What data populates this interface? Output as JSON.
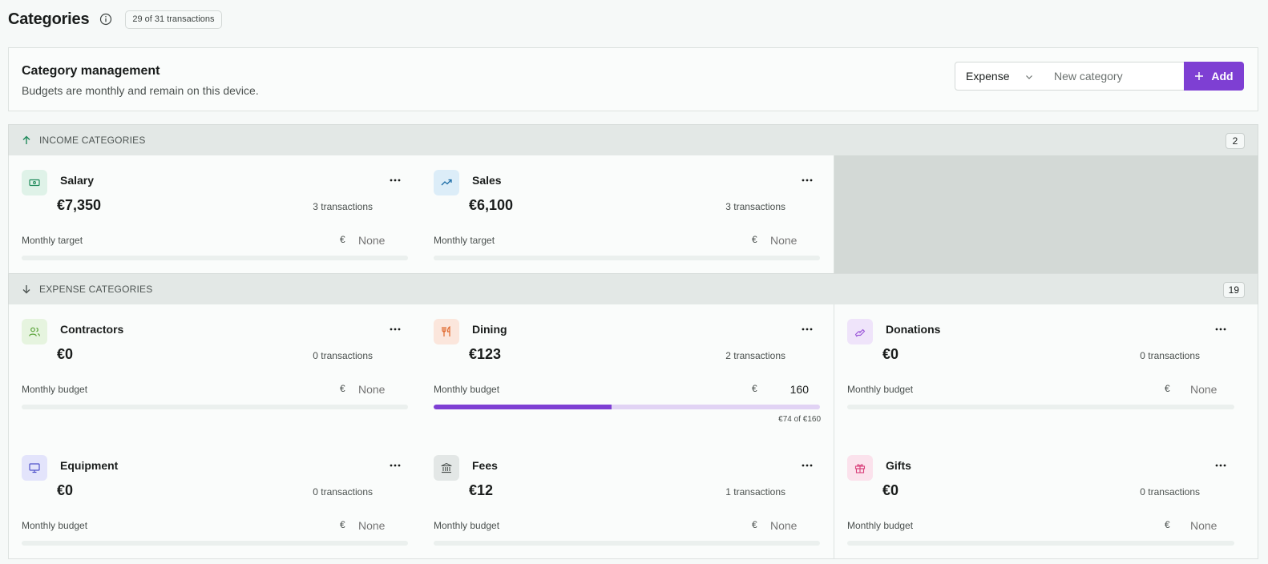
{
  "header": {
    "title": "Categories",
    "count": "29 of 31 transactions"
  },
  "management": {
    "title": "Category management",
    "subtitle": "Budgets are monthly and remain on this device.",
    "type_value": "Expense",
    "new_placeholder": "New category",
    "add_label": "Add"
  },
  "income": {
    "label": "INCOME CATEGORIES",
    "count": "2",
    "items": [
      {
        "name": "Salary",
        "amount": "€7,350",
        "tx": "3 transactions",
        "budget_label": "Monthly target",
        "currency": "€",
        "budget_placeholder": "None",
        "icon": "banknote-icon"
      },
      {
        "name": "Sales",
        "amount": "€6,100",
        "tx": "3 transactions",
        "budget_label": "Monthly target",
        "currency": "€",
        "budget_placeholder": "None",
        "icon": "trending-up-icon"
      }
    ]
  },
  "expense": {
    "label": "EXPENSE CATEGORIES",
    "count": "19",
    "items": [
      {
        "name": "Contractors",
        "amount": "€0",
        "tx": "0 transactions",
        "budget_label": "Monthly budget",
        "currency": "€",
        "budget_placeholder": "None",
        "icon": "users-icon"
      },
      {
        "name": "Dining",
        "amount": "€123",
        "tx": "2 transactions",
        "budget_label": "Monthly budget",
        "currency": "€",
        "budget_value": "160",
        "progress": 0.46,
        "progress_note": "€74 of €160",
        "icon": "utensils-icon"
      },
      {
        "name": "Donations",
        "amount": "€0",
        "tx": "0 transactions",
        "budget_label": "Monthly budget",
        "currency": "€",
        "budget_placeholder": "None",
        "icon": "hand-heart-icon"
      },
      {
        "name": "Equipment",
        "amount": "€0",
        "tx": "0 transactions",
        "budget_label": "Monthly budget",
        "currency": "€",
        "budget_placeholder": "None",
        "icon": "monitor-icon"
      },
      {
        "name": "Fees",
        "amount": "€12",
        "tx": "1 transactions",
        "budget_label": "Monthly budget",
        "currency": "€",
        "budget_placeholder": "None",
        "icon": "bank-icon"
      },
      {
        "name": "Gifts",
        "amount": "€0",
        "tx": "0 transactions",
        "budget_label": "Monthly budget",
        "currency": "€",
        "budget_placeholder": "None",
        "icon": "gift-icon"
      }
    ]
  },
  "colors": {
    "accent": "#7e3fd3",
    "income_arrow": "#1f8a5b"
  }
}
